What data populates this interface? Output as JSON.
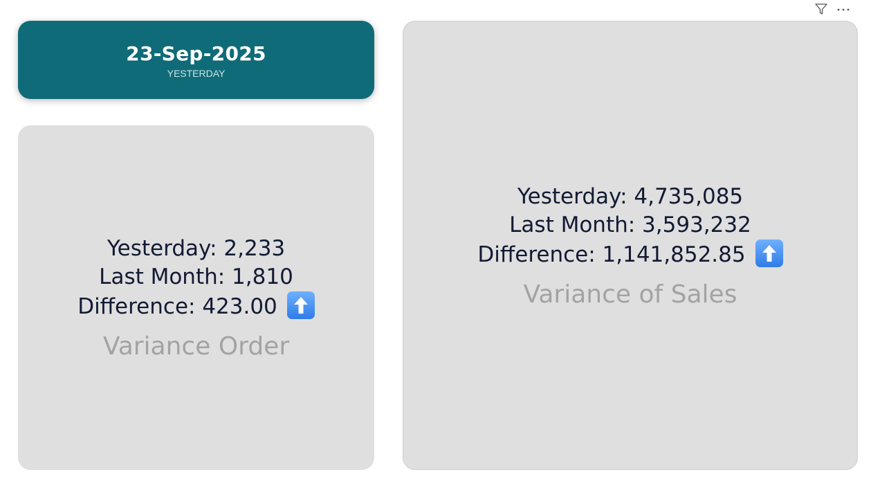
{
  "date_card": {
    "date": "23-Sep-2025",
    "caption": "YESTERDAY",
    "background_color": "#0f6b77"
  },
  "orders_card": {
    "yesterday_line": "Yesterday: 2,233",
    "last_month_line": "Last Month: 1,810",
    "difference_line": "Difference: 423.00",
    "trend_icon": "arrow-up-icon",
    "label": "Variance Order"
  },
  "sales_card": {
    "yesterday_line": "Yesterday: 4,735,085",
    "last_month_line": "Last Month: 3,593,232",
    "difference_line": "Difference: 1,141,852.85",
    "trend_icon": "arrow-up-icon",
    "label": "Variance of Sales"
  },
  "visual_header": {
    "icons": [
      "filter-icon",
      "more-options-icon"
    ]
  },
  "colors": {
    "card_background": "#dfdfdf",
    "value_text": "#121a33",
    "label_text": "#a3a3a3",
    "trend_badge": "#3a86f0"
  }
}
